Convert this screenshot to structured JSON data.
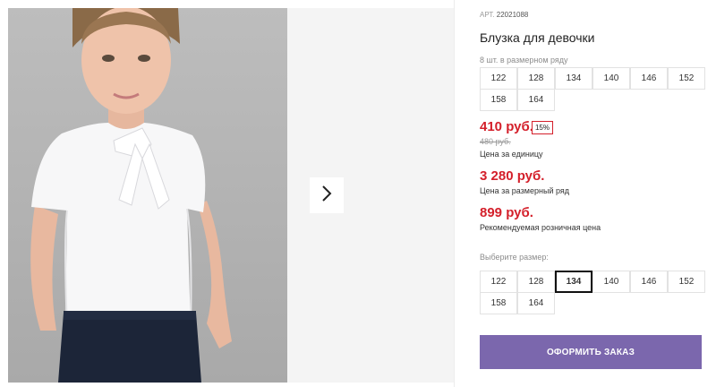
{
  "product": {
    "article_label": "АРТ.",
    "article_number": "22021088",
    "title": "Блузка для девочки"
  },
  "size_row": {
    "label": "8 шт. в размерном ряду",
    "sizes": [
      "122",
      "128",
      "134",
      "140",
      "146",
      "152",
      "158",
      "164"
    ]
  },
  "pricing": {
    "unit_price": "410 руб.",
    "discount": "15%",
    "old_price": "480 руб.",
    "unit_caption": "Цена за единицу",
    "row_price": "3 280 руб.",
    "row_caption": "Цена за размерный ряд",
    "retail_price": "899 руб.",
    "retail_caption": "Рекомендуемая розничная цена"
  },
  "size_select": {
    "label": "Выберите размер:",
    "sizes": [
      "122",
      "128",
      "134",
      "140",
      "146",
      "152",
      "158",
      "164"
    ],
    "selected": "134"
  },
  "order_button": "ОФОРМИТЬ ЗАКАЗ",
  "colors": {
    "price_red": "#d4202b",
    "button_purple": "#7b67ad"
  }
}
